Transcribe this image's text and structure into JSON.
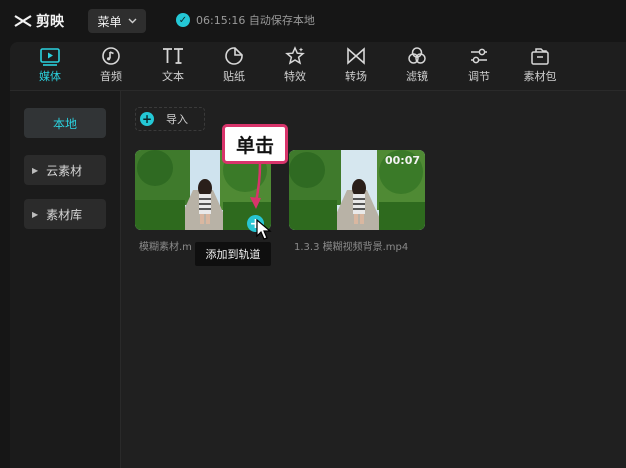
{
  "app": {
    "name": "剪映"
  },
  "header": {
    "menu_label": "菜单",
    "save_status": "06:15:16 自动保存本地"
  },
  "toolbar": {
    "active_color": "#2bd2df",
    "items": [
      {
        "label": "媒体",
        "icon": "media-icon"
      },
      {
        "label": "音频",
        "icon": "audio-icon"
      },
      {
        "label": "文本",
        "icon": "text-icon"
      },
      {
        "label": "贴纸",
        "icon": "sticker-icon"
      },
      {
        "label": "特效",
        "icon": "effects-icon"
      },
      {
        "label": "转场",
        "icon": "transition-icon"
      },
      {
        "label": "滤镜",
        "icon": "filter-icon"
      },
      {
        "label": "调节",
        "icon": "adjust-icon"
      },
      {
        "label": "素材包",
        "icon": "package-icon"
      }
    ]
  },
  "sidebar": {
    "items": [
      {
        "label": "本地"
      },
      {
        "label": "云素材"
      },
      {
        "label": "素材库"
      }
    ]
  },
  "content": {
    "import_label": "导入",
    "media": [
      {
        "caption": "模糊素材.m",
        "tooltip": "添加到轨道"
      },
      {
        "caption": "1.3.3  模糊视频背景.mp4",
        "duration": "00:07"
      }
    ]
  },
  "annotation": {
    "callout": "单击",
    "color": "#d8346b"
  }
}
